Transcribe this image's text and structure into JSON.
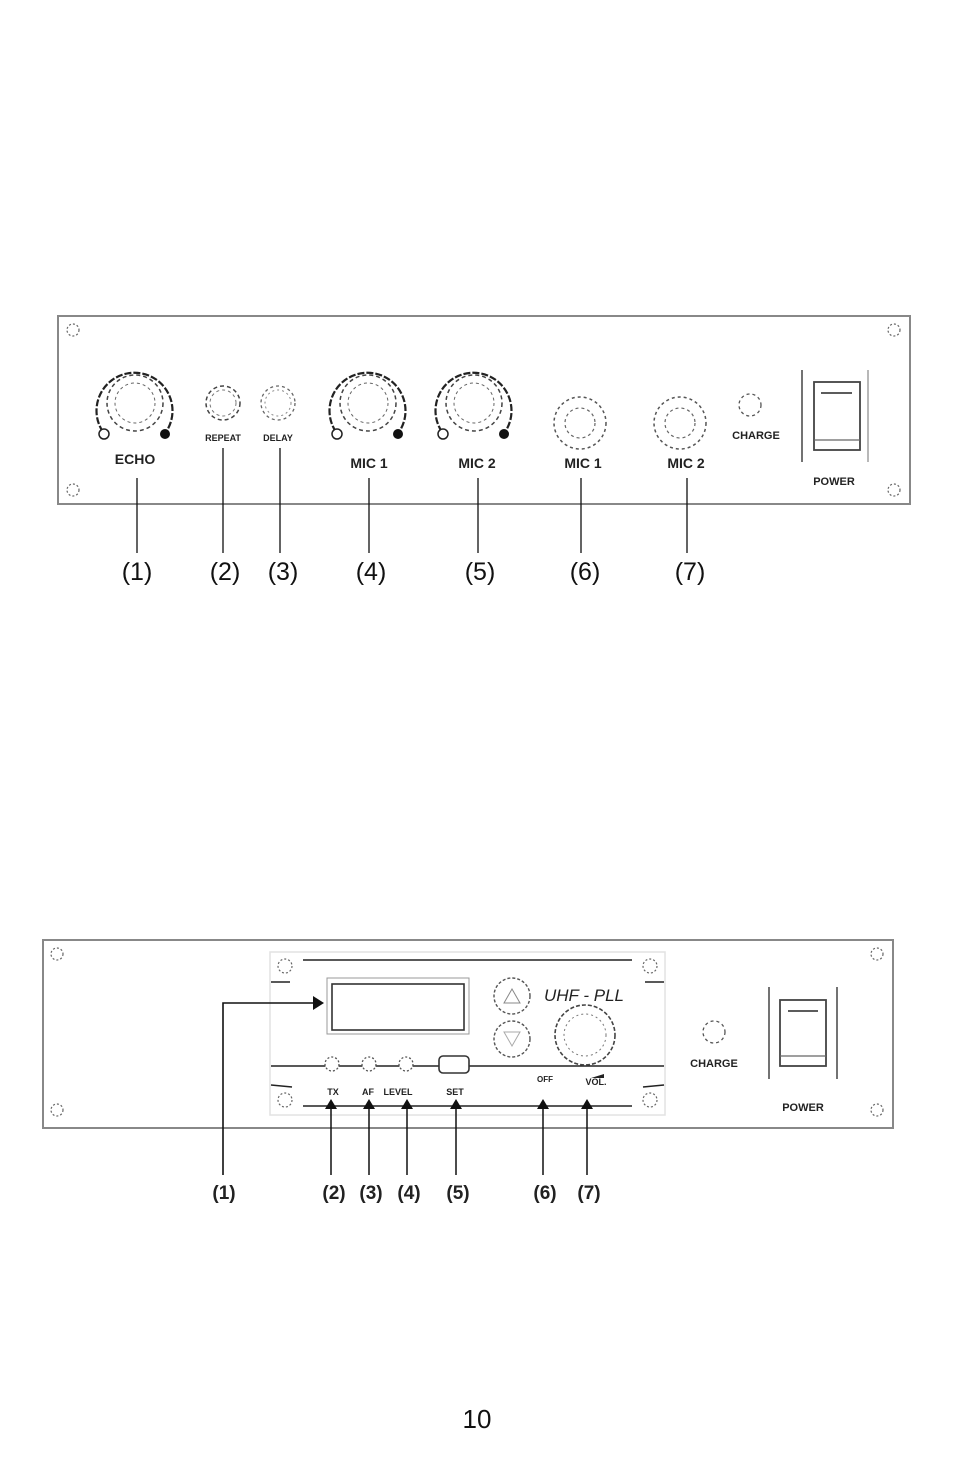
{
  "page_number": "10",
  "panel1": {
    "knob_echo_label": "ECHO",
    "knob_repeat_label": "REPEAT",
    "knob_delay_label": "DELAY",
    "knob_mic1_label": "MIC 1",
    "knob_mic2_label": "MIC 2",
    "jack_mic1_label": "MIC 1",
    "jack_mic2_label": "MIC 2",
    "charge_label": "CHARGE",
    "power_label": "POWER",
    "callouts": [
      "(1)",
      "(2)",
      "(3)",
      "(4)",
      "(5)",
      "(6)",
      "(7)"
    ]
  },
  "panel2": {
    "brand_label": "UHF - PLL",
    "tx_label": "TX",
    "af_label": "AF",
    "level_label": "LEVEL",
    "set_label": "SET",
    "off_label": "OFF",
    "vol_label": "VOL.",
    "charge_label": "CHARGE",
    "power_label": "POWER",
    "callouts": [
      "(1)",
      "(2)",
      "(3)",
      "(4)",
      "(5)",
      "(6)",
      "(7)"
    ]
  }
}
